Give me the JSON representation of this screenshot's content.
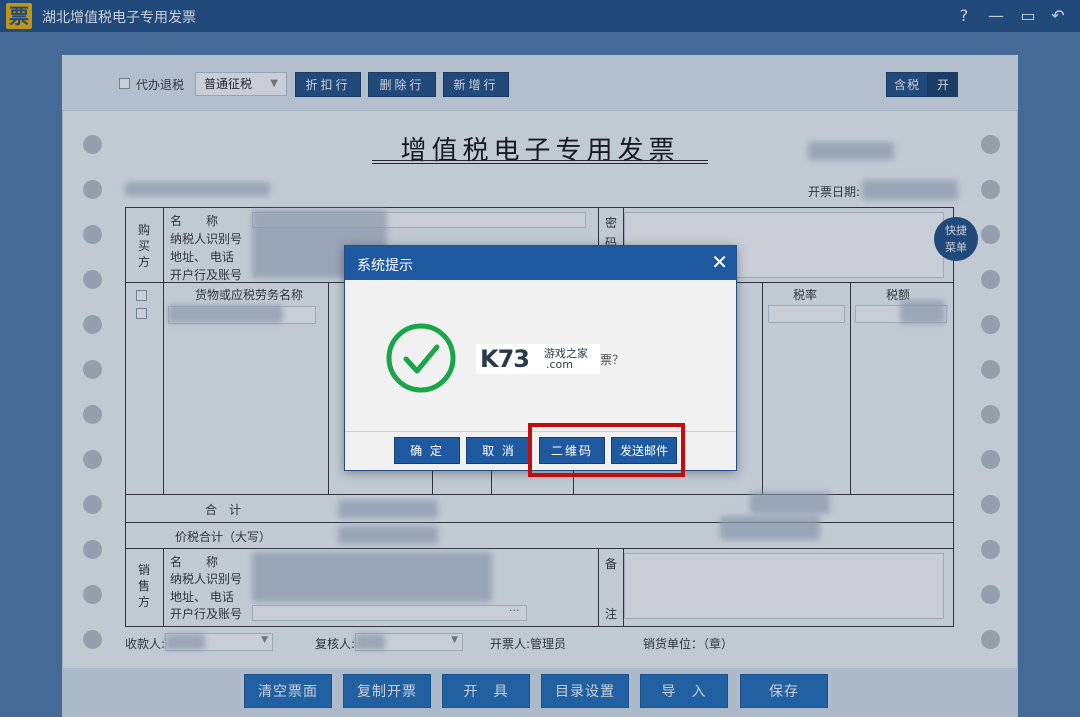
{
  "window": {
    "logo_char": "票",
    "title": "湖北增值税电子专用发票",
    "help": "?",
    "minimize": "—",
    "maximize": "▭",
    "back": "↶"
  },
  "toolbar": {
    "agent_refund_label": "代办退税",
    "tax_type_selected": "普通征税",
    "discount_row": "折扣行",
    "delete_row": "删除行",
    "add_row": "新增行",
    "tax_included": "含税",
    "tax_toggle": "开"
  },
  "invoice": {
    "title": "增值税电子专用发票",
    "date_label": "开票日期:",
    "buyer": {
      "side_label": [
        "购",
        "买",
        "方"
      ],
      "name": "名　　称",
      "tax_id": "纳税人识别号",
      "address": "地址、 电话",
      "bank": "开户行及账号"
    },
    "cipher_label": [
      "密",
      "码"
    ],
    "columns": {
      "goods": "货物或应税劳务名称",
      "tax_rate": "税率",
      "tax_amount": "税额"
    },
    "total_label": "合　计",
    "total_words_label": "价税合计（大写）",
    "seller": {
      "side_label": [
        "销",
        "售",
        "方"
      ],
      "name": "名　　称",
      "tax_id": "纳税人识别号",
      "address": "地址、 电话",
      "bank": "开户行及账号",
      "ellipsis": "···"
    },
    "remarks_label": [
      "备",
      "注"
    ],
    "payee_label": "收款人:",
    "reviewer_label": "复核人:",
    "issuer": "开票人:管理员",
    "seller_unit": "销货单位：（章）"
  },
  "quick_menu": [
    "快捷",
    "菜单"
  ],
  "bottom_buttons": {
    "clear": "清空票面",
    "copy": "复制开票",
    "issue": "开　具",
    "catalog": "目录设置",
    "import": "导　入",
    "save": "保存"
  },
  "dialog": {
    "title": "系统提示",
    "close": "✕",
    "message_tail": "票？",
    "buttons": {
      "ok": "确 定",
      "cancel": "取 消",
      "qr": "二维码",
      "email": "发送邮件"
    }
  },
  "watermark": {
    "brand": "K73",
    "site_cn": "游戏之家",
    "site_com": ".com"
  },
  "colors": {
    "titlebar": "#1f4f86",
    "dialog_header": "#1f5aa0",
    "success_green": "#1aa54a",
    "highlight_red": "#c10d0d"
  }
}
